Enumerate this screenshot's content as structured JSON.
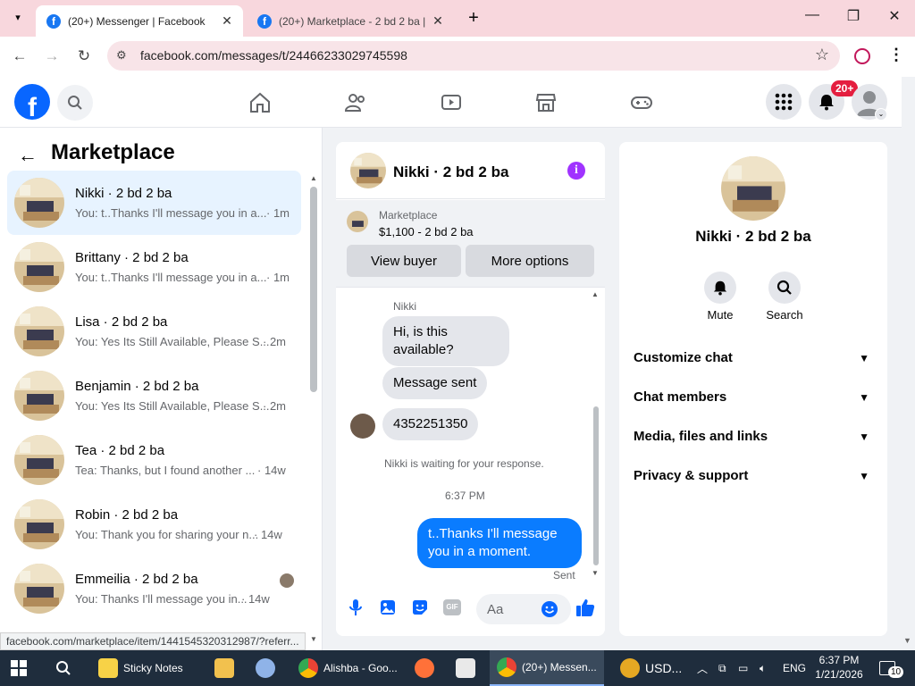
{
  "browser": {
    "tabs": [
      {
        "title": "(20+) Messenger | Facebook",
        "active": true
      },
      {
        "title": "(20+) Marketplace - 2 bd 2 ba |",
        "active": false
      }
    ],
    "url": "facebook.com/messages/t/24466233029745598",
    "status_url": "facebook.com/marketplace/item/1441545320312987/?referr..."
  },
  "header": {
    "notification_count": "20+"
  },
  "left": {
    "title": "Marketplace",
    "conversations": [
      {
        "name": "Nikki · 2 bd 2 ba",
        "preview": "You: t..Thanks I'll message you in a...",
        "time": "· 1m",
        "selected": true
      },
      {
        "name": "Brittany · 2 bd 2 ba",
        "preview": "You: t..Thanks I'll message you in a...",
        "time": "· 1m"
      },
      {
        "name": "Lisa · 2 bd 2 ba",
        "preview": "You: Yes Its Still Available, Please S...",
        "time": "· 2m"
      },
      {
        "name": "Benjamin · 2 bd 2 ba",
        "preview": "You: Yes Its Still Available, Please S...",
        "time": "· 2m"
      },
      {
        "name": "Tea · 2 bd 2 ba",
        "preview": "Tea: Thanks, but I found another ...",
        "time": "· 14w"
      },
      {
        "name": "Robin · 2 bd 2 ba",
        "preview": "You: Thank you for sharing your n...",
        "time": "· 14w"
      },
      {
        "name": "Emmeilia · 2 bd 2 ba",
        "preview": "You: Thanks I'll message you in...",
        "time": "· 14w"
      }
    ]
  },
  "chat": {
    "name": "Nikki · 2 bd 2 ba",
    "listing_label": "Marketplace",
    "listing_price": "$1,100 - 2 bd 2 ba",
    "view_buyer": "View buyer",
    "more_options": "More options",
    "sender_name": "Nikki",
    "messages": [
      {
        "text": "Hi, is this available?"
      },
      {
        "text": "Message sent"
      },
      {
        "text": "4352251350"
      }
    ],
    "waiting_text": "Nikki is waiting for your response.",
    "timestamp": "6:37 PM",
    "my_message": "t..Thanks I'll message you in a moment.",
    "sent_label": "Sent",
    "input_placeholder": "Aa"
  },
  "info": {
    "name": "Nikki · 2 bd 2 ba",
    "mute": "Mute",
    "search": "Search",
    "sections": [
      "Customize chat",
      "Chat members",
      "Media, files and links",
      "Privacy & support"
    ]
  },
  "taskbar": {
    "items": [
      "Sticky Notes",
      "Alishba - Goo...",
      "(20+) Messen...",
      "USD..."
    ],
    "lang": "ENG",
    "time": "6:37 PM",
    "date": "1/21/2026",
    "notif_count": "10"
  },
  "colors": {
    "facebook_blue": "#0866ff",
    "my_bubble": "#0a7cff",
    "selected_row": "#e7f3ff",
    "badge_red": "#e41e3f",
    "info_purple": "#a033ff"
  }
}
